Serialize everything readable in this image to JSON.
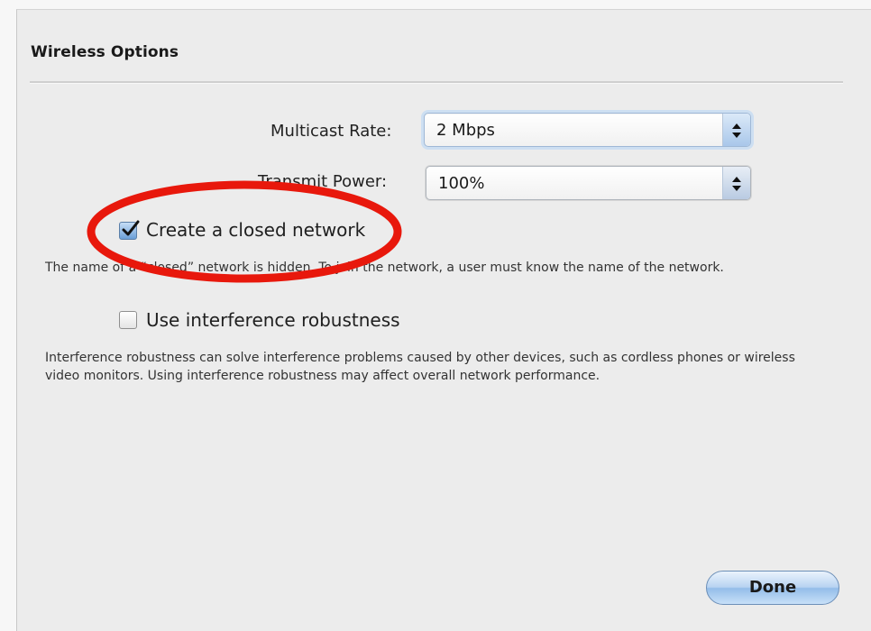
{
  "section": {
    "title": "Wireless Options"
  },
  "multicast": {
    "label": "Multicast Rate:",
    "value": "2 Mbps"
  },
  "transmit": {
    "label": "Transmit Power:",
    "value": "100%"
  },
  "closed_network": {
    "label": "Create a closed network",
    "checked": true,
    "description": "The name of a “closed” network is hidden. To join the network, a user must know the name of the network."
  },
  "interference": {
    "label": "Use interference robustness",
    "checked": false,
    "description": "Interference robustness can solve interference problems caused by other devices, such as cordless phones or wireless video monitors. Using interference robustness may affect overall network performance."
  },
  "actions": {
    "done_label": "Done"
  },
  "colors": {
    "highlight": "#e8180c",
    "accent": "#7fb0e6"
  }
}
